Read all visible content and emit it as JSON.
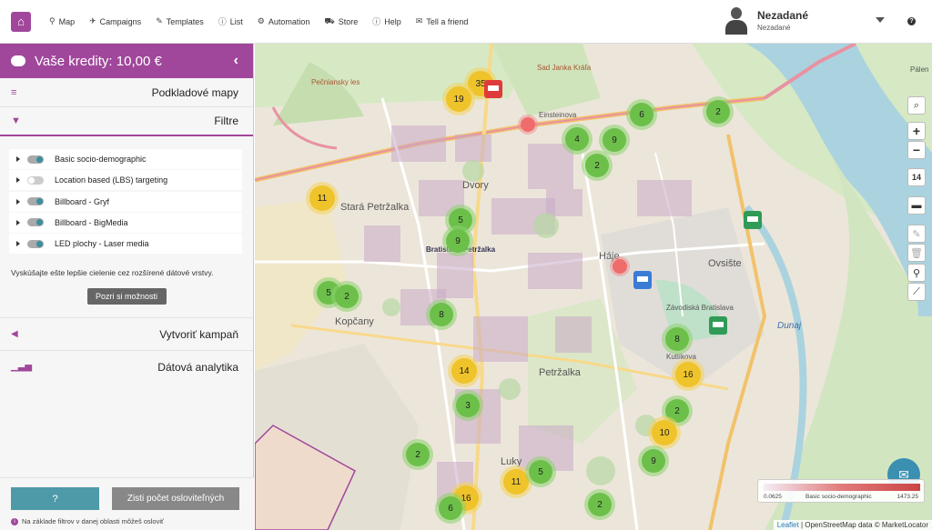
{
  "topbar": {
    "logo_icon": "map-user-icon",
    "nav": [
      {
        "icon": "pin-icon",
        "glyph": "⚲",
        "label": "Map"
      },
      {
        "icon": "megaphone-icon",
        "glyph": "✈",
        "label": "Campaigns"
      },
      {
        "icon": "pencil-icon",
        "glyph": "✎",
        "label": "Templates"
      },
      {
        "icon": "info-icon",
        "glyph": "ⓘ",
        "label": "List"
      },
      {
        "icon": "gears-icon",
        "glyph": "⚙",
        "label": "Automation"
      },
      {
        "icon": "cart-icon",
        "glyph": "⛟",
        "label": "Store"
      },
      {
        "icon": "info-circle-icon",
        "glyph": "ⓘ",
        "label": "Help"
      },
      {
        "icon": "share-icon",
        "glyph": "✉",
        "label": "Tell a friend"
      }
    ],
    "user": {
      "name": "Nezadané",
      "sub": "Nezadané"
    }
  },
  "sidebar": {
    "credits_label": "Vaše kredity: 10,00 €",
    "base_maps": "Podkladové mapy",
    "filters_title": "Filtre",
    "filters": [
      {
        "label": "Basic socio-demographic",
        "on": true
      },
      {
        "label": "Location based (LBS) targeting",
        "on": false
      },
      {
        "label": "Billboard - Gryf",
        "on": true
      },
      {
        "label": "Billboard - BigMedia",
        "on": true
      },
      {
        "label": "LED plochy - Laser media",
        "on": true
      }
    ],
    "hint": "Vyskúšajte ešte lepšie cielenie cez rozšírené dátové vrstvy.",
    "more_button": "Pozri si možnosti",
    "create_campaign": "Vytvoriť kampaň",
    "analytics": "Dátová analytika",
    "question_button": "?",
    "count_button": "Zisti počet osloviteľných",
    "footnote": "Na základe filtrov v danej oblasti môžeš osloviť"
  },
  "map": {
    "zoom": "14",
    "labels": {
      "dvory": "Dvory",
      "stara": "Stará Petržalka",
      "haje": "Háje",
      "petrzalka": "Petržalka",
      "luky": "Luky",
      "kopcany": "Kopčany",
      "ovsiste": "Ovsište",
      "dunaj": "Dunaj",
      "pecniansky": "Pečniansky les",
      "sad": "Sad Janka Kráľa",
      "einsteinova": "Einsteinova",
      "bratislava_petrzalka": "Bratislava-Petržalka",
      "zavodiska": "Závodiská Bratislava",
      "kutlikova": "Kutlíkova",
      "palenisko": "Pálen"
    },
    "clusters": [
      {
        "n": "35",
        "c": "y"
      },
      {
        "n": "19",
        "c": "y"
      },
      {
        "n": "11",
        "c": "y"
      },
      {
        "n": "6",
        "c": "g"
      },
      {
        "n": "2",
        "c": "g"
      },
      {
        "n": "4",
        "c": "g"
      },
      {
        "n": "9",
        "c": "g"
      },
      {
        "n": "2",
        "c": "g"
      },
      {
        "n": "5",
        "c": "g"
      },
      {
        "n": "9",
        "c": "g"
      },
      {
        "n": "5",
        "c": "g"
      },
      {
        "n": "2",
        "c": "g"
      },
      {
        "n": "8",
        "c": "g"
      },
      {
        "n": "14",
        "c": "y"
      },
      {
        "n": "3",
        "c": "g"
      },
      {
        "n": "2",
        "c": "g"
      },
      {
        "n": "8",
        "c": "g"
      },
      {
        "n": "16",
        "c": "y"
      },
      {
        "n": "2",
        "c": "g"
      },
      {
        "n": "10",
        "c": "y"
      },
      {
        "n": "9",
        "c": "g"
      },
      {
        "n": "11",
        "c": "y"
      },
      {
        "n": "5",
        "c": "g"
      },
      {
        "n": "16",
        "c": "y"
      },
      {
        "n": "6",
        "c": "g"
      },
      {
        "n": "2",
        "c": "g"
      }
    ],
    "legend": {
      "low": "0.0625",
      "name": "Basic socio-demographic",
      "high": "1473.25"
    },
    "attribution": {
      "leaflet": "Leaflet",
      "rest": " | OpenStreetMap data © MarketLocator"
    }
  }
}
